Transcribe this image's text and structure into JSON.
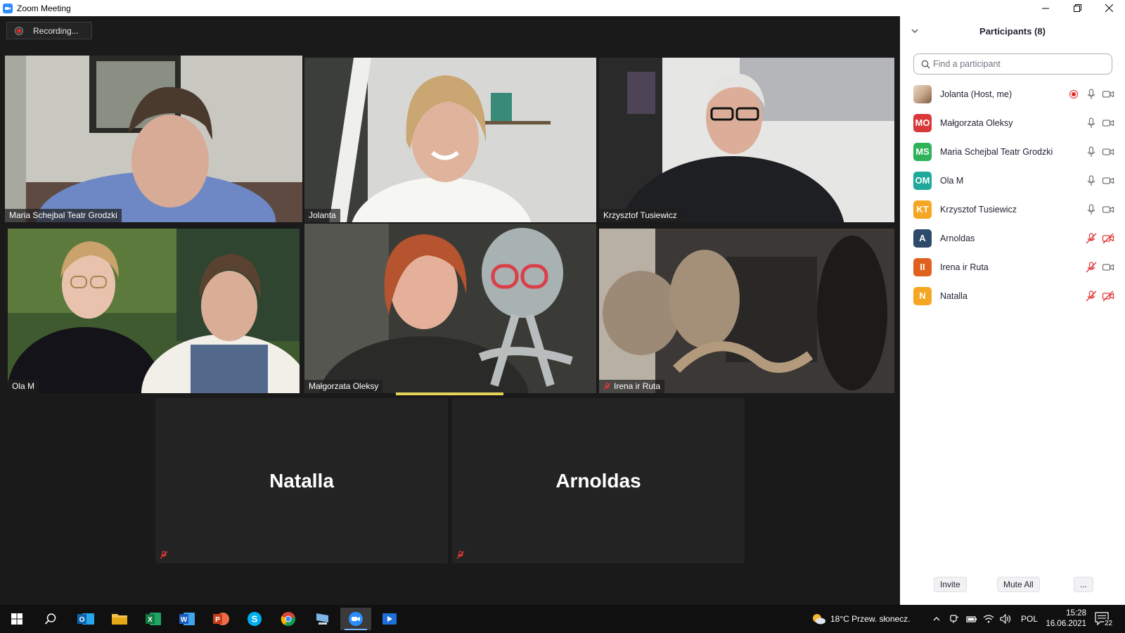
{
  "window": {
    "title": "Zoom Meeting"
  },
  "recording": {
    "label": "Recording..."
  },
  "video_tiles": [
    {
      "name": "Maria Schejbal Teatr Grodzki",
      "muted": false,
      "active_speaker": true
    },
    {
      "name": "Jolanta",
      "muted": false,
      "active_speaker": false
    },
    {
      "name": "Krzysztof Tusiewicz",
      "muted": false,
      "active_speaker": false
    },
    {
      "name": "Ola M",
      "muted": false,
      "active_speaker": false
    },
    {
      "name": "Małgorzata Oleksy",
      "muted": false,
      "active_speaker": false
    },
    {
      "name": "Irena ir Ruta",
      "muted": true,
      "active_speaker": false
    }
  ],
  "avatar_tiles": [
    {
      "name": "Natalla",
      "muted": true
    },
    {
      "name": "Arnoldas",
      "muted": true
    }
  ],
  "participants_panel": {
    "title": "Participants (8)",
    "search_placeholder": "Find a participant",
    "participants": [
      {
        "initials": "",
        "name": "Jolanta (Host, me)",
        "color": "#c9a98c",
        "recording": true,
        "mic_muted": false,
        "video_off": false
      },
      {
        "initials": "MO",
        "name": "Małgorzata Oleksy",
        "color": "#d9383a",
        "recording": false,
        "mic_muted": false,
        "video_off": false
      },
      {
        "initials": "MS",
        "name": "Maria Schejbal Teatr Grodzki",
        "color": "#2fb25a",
        "recording": false,
        "mic_muted": false,
        "video_off": false
      },
      {
        "initials": "OM",
        "name": "Ola M",
        "color": "#1fa89c",
        "recording": false,
        "mic_muted": false,
        "video_off": false
      },
      {
        "initials": "KT",
        "name": "Krzysztof Tusiewicz",
        "color": "#f5a623",
        "recording": false,
        "mic_muted": false,
        "video_off": false
      },
      {
        "initials": "A",
        "name": "Arnoldas",
        "color": "#2e4a6b",
        "recording": false,
        "mic_muted": true,
        "video_off": true
      },
      {
        "initials": "II",
        "name": "Irena ir Ruta",
        "color": "#e0611e",
        "recording": false,
        "mic_muted": true,
        "video_off": false
      },
      {
        "initials": "N",
        "name": "Natalla",
        "color": "#f5a623",
        "recording": false,
        "mic_muted": true,
        "video_off": true
      }
    ],
    "buttons": {
      "invite": "Invite",
      "mute_all": "Mute All",
      "more": "..."
    }
  },
  "taskbar": {
    "weather": "18°C  Przew. słonecz.",
    "language": "POL",
    "time": "15:28",
    "date": "16.06.2021",
    "notifications": "22"
  }
}
